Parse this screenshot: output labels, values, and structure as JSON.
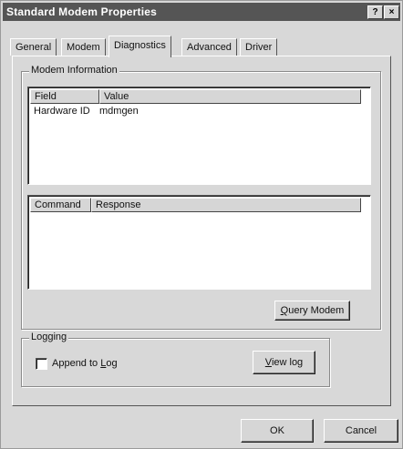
{
  "window": {
    "title": "Standard Modem Properties",
    "help_glyph": "?",
    "close_glyph": "×"
  },
  "tabs": [
    {
      "label": "General"
    },
    {
      "label": "Modem"
    },
    {
      "label": "Diagnostics"
    },
    {
      "label": "Advanced"
    },
    {
      "label": "Driver"
    }
  ],
  "modem_info": {
    "group_title": "Modem Information",
    "info_table": {
      "columns": [
        "Field",
        "Value"
      ],
      "rows": [
        {
          "field": "Hardware ID",
          "value": "mdmgen"
        }
      ]
    },
    "command_table": {
      "columns": [
        "Command",
        "Response"
      ]
    },
    "query_button": {
      "prefix": "",
      "mnemonic": "Q",
      "suffix": "uery Modem"
    }
  },
  "logging": {
    "group_title": "Logging",
    "append_checkbox": {
      "prefix": "Append to ",
      "mnemonic": "L",
      "suffix": "og",
      "checked": false
    },
    "view_log_button": {
      "prefix": "",
      "mnemonic": "V",
      "suffix": "iew log"
    }
  },
  "footer": {
    "ok_label": "OK",
    "cancel_label": "Cancel"
  }
}
